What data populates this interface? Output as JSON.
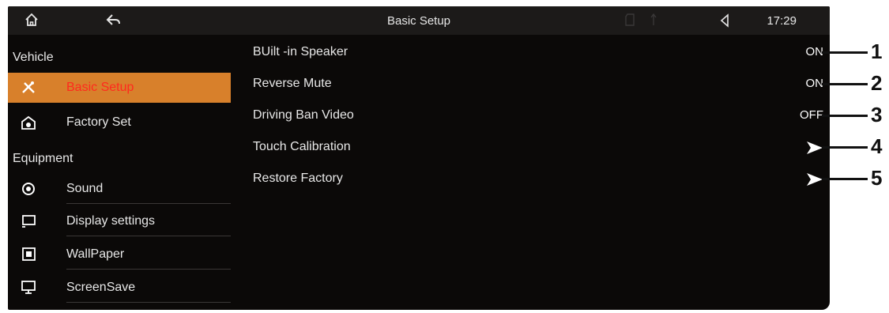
{
  "topbar": {
    "title": "Basic Setup",
    "time": "17:29",
    "icons": [
      "home-icon",
      "back-icon",
      "sd-card-icon",
      "usb-icon",
      "volume-icon"
    ]
  },
  "sidebar": {
    "section_vehicle": "Vehicle",
    "section_equipment": "Equipment",
    "items": [
      {
        "label": "Basic Setup",
        "icon": "wrench-screwdriver-icon",
        "active": true
      },
      {
        "label": "Factory Set",
        "icon": "factory-icon",
        "active": false
      },
      {
        "label": "Sound",
        "icon": "speaker-icon",
        "active": false
      },
      {
        "label": "Display settings",
        "icon": "display-icon",
        "active": false
      },
      {
        "label": "WallPaper",
        "icon": "wallpaper-icon",
        "active": false
      },
      {
        "label": "ScreenSave",
        "icon": "monitor-icon",
        "active": false
      }
    ]
  },
  "settings": [
    {
      "label": "BUilt -in  Speaker",
      "value": "ON"
    },
    {
      "label": "Reverse Mute",
      "value": "ON"
    },
    {
      "label": "Driving Ban Video",
      "value": "OFF"
    },
    {
      "label": "Touch Calibration",
      "value": "arrow"
    },
    {
      "label": "Restore Factory",
      "value": "arrow"
    }
  ],
  "callouts": [
    "1",
    "2",
    "3",
    "4",
    "5"
  ],
  "colors": {
    "active_bg": "#d8802b",
    "active_text": "#ff2a1e",
    "background": "#0b0908",
    "topbar": "#1c1a19"
  }
}
